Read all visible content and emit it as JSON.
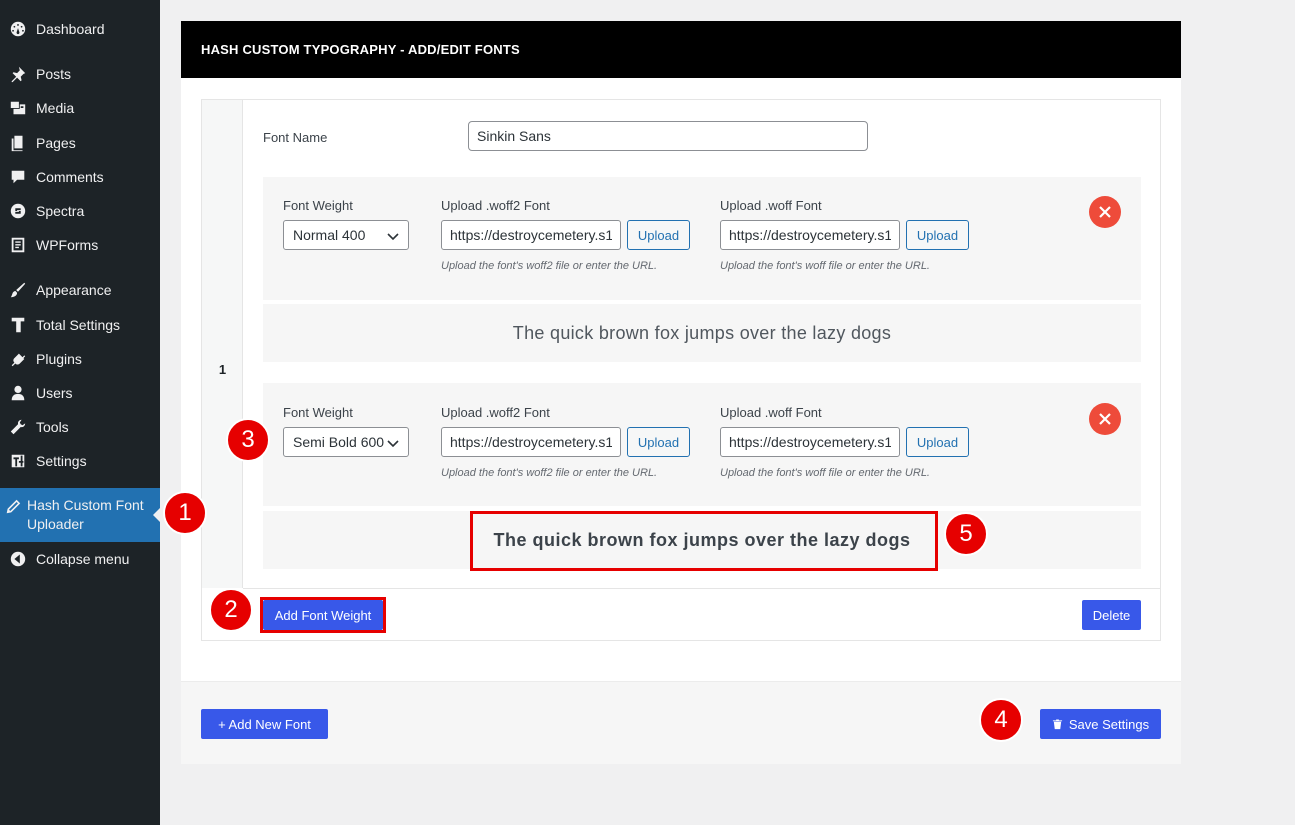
{
  "sidebar": {
    "items": [
      {
        "label": "Dashboard",
        "icon": "dashboard-icon"
      },
      {
        "label": "Posts",
        "icon": "pin-icon"
      },
      {
        "label": "Media",
        "icon": "media-icon"
      },
      {
        "label": "Pages",
        "icon": "pages-icon"
      },
      {
        "label": "Comments",
        "icon": "comment-icon"
      },
      {
        "label": "Spectra",
        "icon": "spectra-icon"
      },
      {
        "label": "WPForms",
        "icon": "wpforms-icon"
      },
      {
        "label": "Appearance",
        "icon": "brush-icon"
      },
      {
        "label": "Total Settings",
        "icon": "total-settings-icon"
      },
      {
        "label": "Plugins",
        "icon": "plug-icon"
      },
      {
        "label": "Users",
        "icon": "user-icon"
      },
      {
        "label": "Tools",
        "icon": "wrench-icon"
      },
      {
        "label": "Settings",
        "icon": "sliders-icon"
      },
      {
        "label": "Hash Custom Font Uploader",
        "icon": "pencil-icon",
        "active": true
      },
      {
        "label": "Collapse menu",
        "icon": "collapse-icon"
      }
    ]
  },
  "panel": {
    "title": "HASH CUSTOM TYPOGRAPHY - ADD/EDIT FONTS",
    "font_index": "1",
    "font_name_label": "Font Name",
    "font_name_value": "Sinkin Sans",
    "weights": [
      {
        "weight_label": "Font Weight",
        "weight_value": "Normal 400",
        "woff2_label": "Upload .woff2 Font",
        "woff2_value": "https://destroycemetery.s1",
        "woff2_hint": "Upload the font's woff2 file or enter the URL.",
        "woff_label": "Upload .woff Font",
        "woff_value": "https://destroycemetery.s1",
        "woff_hint": "Upload the font's woff file or enter the URL.",
        "upload_label": "Upload",
        "preview": "The quick brown fox jumps over the lazy dogs"
      },
      {
        "weight_label": "Font Weight",
        "weight_value": "Semi Bold 600",
        "woff2_label": "Upload .woff2 Font",
        "woff2_value": "https://destroycemetery.s1",
        "woff2_hint": "Upload the font's woff2 file or enter the URL.",
        "woff_label": "Upload .woff Font",
        "woff_value": "https://destroycemetery.s1",
        "woff_hint": "Upload the font's woff file or enter the URL.",
        "upload_label": "Upload",
        "preview": "The quick brown fox jumps over the lazy dogs"
      }
    ],
    "add_weight_label": "Add Font Weight",
    "delete_label": "Delete",
    "add_font_label": "+ Add New Font",
    "save_label": "Save Settings"
  },
  "annotations": [
    "1",
    "2",
    "3",
    "4",
    "5"
  ],
  "colors": {
    "sidebar_bg": "#1d2327",
    "active_bg": "#2271b1",
    "button_blue": "#3858e9",
    "annotation_red": "#e60000",
    "remove_red": "#ee4b3a"
  }
}
